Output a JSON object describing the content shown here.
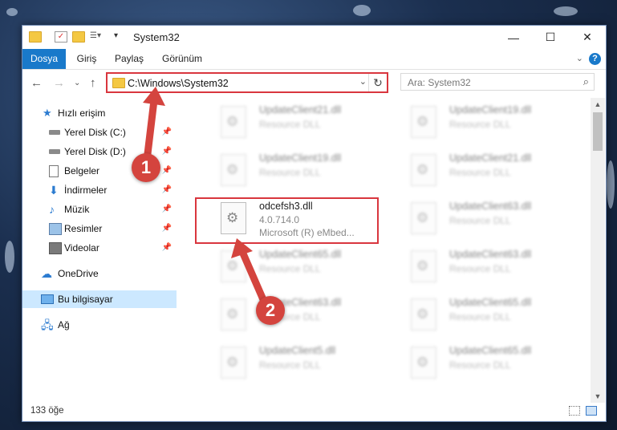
{
  "window": {
    "title": "System32"
  },
  "ribbon": {
    "tabs": [
      "Dosya",
      "Giriş",
      "Paylaş",
      "Görünüm"
    ],
    "help_label": "?"
  },
  "navbar": {
    "address": "C:\\Windows\\System32",
    "search_placeholder": "Ara: System32"
  },
  "sidebar": {
    "items": [
      {
        "label": "Hızlı erişim",
        "icon": "star-icon"
      },
      {
        "label": "Yerel Disk (C:)",
        "icon": "drive-icon",
        "pinned": true
      },
      {
        "label": "Yerel Disk (D:)",
        "icon": "drive-icon",
        "pinned": true
      },
      {
        "label": "Belgeler",
        "icon": "documents-icon",
        "pinned": true
      },
      {
        "label": "İndirmeler",
        "icon": "download-icon",
        "pinned": true
      },
      {
        "label": "Müzik",
        "icon": "music-icon",
        "pinned": true
      },
      {
        "label": "Resimler",
        "icon": "pictures-icon",
        "pinned": true
      },
      {
        "label": "Videolar",
        "icon": "videos-icon",
        "pinned": true
      },
      {
        "label": "OneDrive",
        "icon": "cloud-icon"
      },
      {
        "label": "Bu bilgisayar",
        "icon": "computer-icon",
        "selected": true
      },
      {
        "label": "Ağ",
        "icon": "network-icon"
      }
    ]
  },
  "files": [
    {
      "name": "UpdateClient21.dll",
      "type": "Resource DLL"
    },
    {
      "name": "UpdateClient19.dll",
      "type": "Resource DLL"
    },
    {
      "name": "UpdateClient19.dll",
      "type": "Resource DLL"
    },
    {
      "name": "UpdateClient21.dll",
      "type": "Resource DLL"
    },
    {
      "name": "odcefsh3.dll",
      "version": "4.0.714.0",
      "company": "Microsoft (R) eMbed..."
    },
    {
      "name": "UpdateClient63.dll",
      "type": "Resource DLL"
    },
    {
      "name": "UpdateClient65.dll",
      "type": "Resource DLL"
    },
    {
      "name": "UpdateClient63.dll",
      "type": "Resource DLL"
    },
    {
      "name": "UpdateClient63.dll",
      "type": "Resource DLL"
    },
    {
      "name": "UpdateClient65.dll",
      "type": "Resource DLL"
    },
    {
      "name": "UpdateClient5.dll",
      "type": "Resource DLL"
    },
    {
      "name": "UpdateClient65.dll",
      "type": "Resource DLL"
    }
  ],
  "status": {
    "count": "133 öğe"
  },
  "callouts": [
    "1",
    "2"
  ],
  "colors": {
    "accent": "#1979ca",
    "highlight": "#d9363e",
    "callout": "#d4443e",
    "selected_bg": "#cce8ff"
  }
}
